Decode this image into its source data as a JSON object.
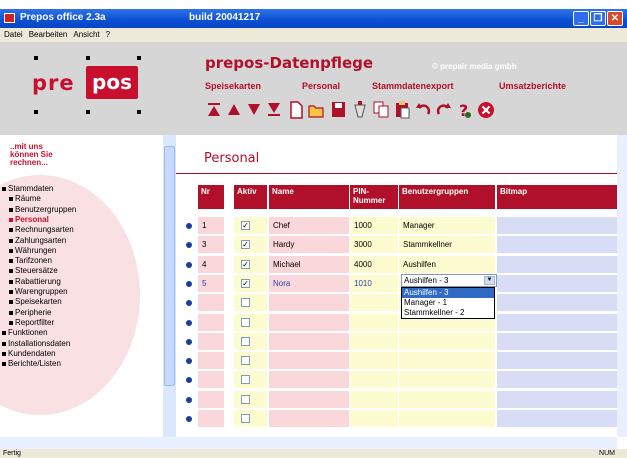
{
  "window": {
    "title": "Prepos office 2.3a",
    "build": "build 20041217"
  },
  "menu": [
    "Datei",
    "Bearbeiten",
    "Ansicht",
    "?"
  ],
  "header": {
    "logo_left": "pre",
    "logo_right": "pos",
    "app_title": "prepos-Datenpflege",
    "copyright": "© prepair media gmbh",
    "nav": [
      "Speisekarten",
      "Personal",
      "Stammdatenexport",
      "Umsatzberichte"
    ]
  },
  "sidebar": {
    "slogan": [
      "..mit uns",
      "können Sie",
      "rechnen..."
    ],
    "items": [
      {
        "label": "Stammdaten",
        "level": 0
      },
      {
        "label": "Räume",
        "level": 1
      },
      {
        "label": "Benutzergruppen",
        "level": 1
      },
      {
        "label": "Personal",
        "level": 1,
        "active": true
      },
      {
        "label": "Rechnungsarten",
        "level": 1
      },
      {
        "label": "Zahlungsarten",
        "level": 1
      },
      {
        "label": "Währungen",
        "level": 1
      },
      {
        "label": "Tarifzonen",
        "level": 1
      },
      {
        "label": "Steuersätze",
        "level": 1
      },
      {
        "label": "Rabattierung",
        "level": 1
      },
      {
        "label": "Warengruppen",
        "level": 1
      },
      {
        "label": "Speisekarten",
        "level": 1
      },
      {
        "label": "Peripherie",
        "level": 1
      },
      {
        "label": "Reportfilter",
        "level": 1
      },
      {
        "label": "Funktionen",
        "level": 0
      },
      {
        "label": "Installationsdaten",
        "level": 0
      },
      {
        "label": "Kundendaten",
        "level": 0
      },
      {
        "label": "Berichte/Listen",
        "level": 0
      }
    ]
  },
  "content": {
    "title": "Personal",
    "columns": [
      "Nr",
      "Aktiv",
      "Name",
      "PIN-\nNummer",
      "Benutzergruppen",
      "Bitmap"
    ],
    "rows": [
      {
        "nr": "1",
        "aktiv": true,
        "name": "Chef",
        "pin": "1000",
        "group": "Manager"
      },
      {
        "nr": "3",
        "aktiv": true,
        "name": "Hardy",
        "pin": "3000",
        "group": "Stammkellner"
      },
      {
        "nr": "4",
        "aktiv": true,
        "name": "Michael",
        "pin": "4000",
        "group": "Aushilfen"
      },
      {
        "nr": "5",
        "aktiv": true,
        "name": "Nora",
        "pin": "1010",
        "group": ""
      },
      {
        "nr": "",
        "aktiv": false,
        "name": "",
        "pin": "",
        "group": ""
      },
      {
        "nr": "",
        "aktiv": false,
        "name": "",
        "pin": "",
        "group": ""
      },
      {
        "nr": "",
        "aktiv": false,
        "name": "",
        "pin": "",
        "group": ""
      },
      {
        "nr": "",
        "aktiv": false,
        "name": "",
        "pin": "",
        "group": ""
      },
      {
        "nr": "",
        "aktiv": false,
        "name": "",
        "pin": "",
        "group": ""
      },
      {
        "nr": "",
        "aktiv": false,
        "name": "",
        "pin": "",
        "group": ""
      },
      {
        "nr": "",
        "aktiv": false,
        "name": "",
        "pin": "",
        "group": ""
      }
    ],
    "dropdown": {
      "value": "Aushilfen - 3",
      "options": [
        "Aushilfen - 3",
        "Manager - 1",
        "Stammkellner - 2"
      ]
    }
  },
  "statusbar": {
    "left": "Fertig",
    "right": "NUM"
  }
}
